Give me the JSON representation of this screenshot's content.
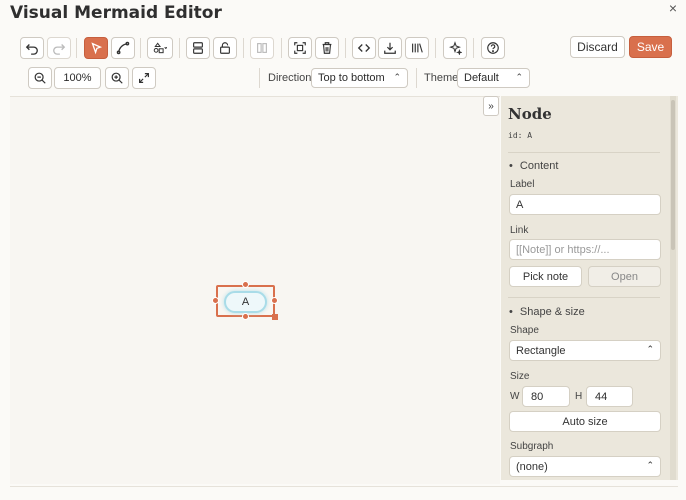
{
  "app": {
    "title": "Visual Mermaid Editor",
    "close_glyph": "×",
    "accent_color": "#d9704d"
  },
  "toolbar": {
    "discard_label": "Discard",
    "save_label": "Save",
    "zoom_value": "100%",
    "direction_label": "Direction",
    "direction_value": "Top to bottom",
    "theme_label": "Theme",
    "theme_value": "Default",
    "icons": [
      "undo-icon",
      "redo-icon",
      "pointer-icon",
      "connect-icon",
      "add-shape-icon",
      "layout-icon",
      "lock-icon",
      "align-icon",
      "select-frame-icon",
      "delete-icon",
      "code-icon",
      "download-icon",
      "library-icon",
      "magic-icon",
      "help-icon",
      "zoom-out-icon",
      "zoom-in-icon",
      "fit-icon"
    ]
  },
  "canvas": {
    "node_text": "A",
    "collapse_glyph": "»"
  },
  "panel": {
    "title": "Node",
    "id_text": "id: A",
    "content_section": "Content",
    "label_label": "Label",
    "label_value": "A",
    "link_label": "Link",
    "link_placeholder": "[[Note]] or https://...",
    "pick_note_label": "Pick note",
    "open_label": "Open",
    "shape_section": "Shape & size",
    "shape_label": "Shape",
    "shape_value": "Rectangle",
    "size_label": "Size",
    "w_label": "W",
    "w_value": "80",
    "h_label": "H",
    "h_value": "44",
    "auto_size_label": "Auto size",
    "subgraph_label": "Subgraph",
    "subgraph_value": "(none)",
    "bullet": "•"
  }
}
